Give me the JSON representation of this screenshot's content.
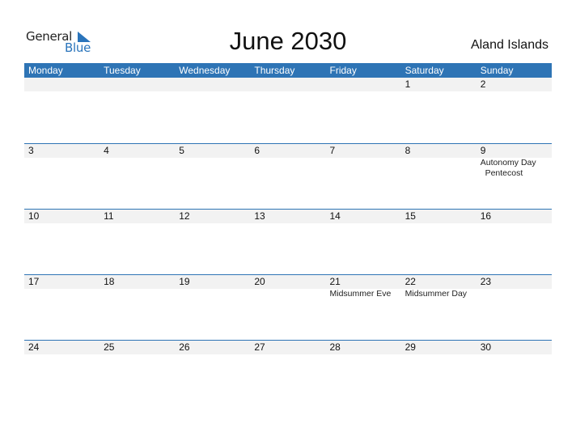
{
  "brand": {
    "general": "General",
    "blue": "Blue",
    "accent": "#2e74b5"
  },
  "title": "June 2030",
  "country": "Aland Islands",
  "days_header": [
    "Monday",
    "Tuesday",
    "Wednesday",
    "Thursday",
    "Friday",
    "Saturday",
    "Sunday"
  ],
  "weeks": [
    [
      {
        "d": ""
      },
      {
        "d": ""
      },
      {
        "d": ""
      },
      {
        "d": ""
      },
      {
        "d": ""
      },
      {
        "d": "1"
      },
      {
        "d": "2"
      }
    ],
    [
      {
        "d": "3"
      },
      {
        "d": "4"
      },
      {
        "d": "5"
      },
      {
        "d": "6"
      },
      {
        "d": "7"
      },
      {
        "d": "8"
      },
      {
        "d": "9",
        "events": [
          "Autonomy Day",
          "  Pentecost"
        ]
      }
    ],
    [
      {
        "d": "10"
      },
      {
        "d": "11"
      },
      {
        "d": "12"
      },
      {
        "d": "13"
      },
      {
        "d": "14"
      },
      {
        "d": "15"
      },
      {
        "d": "16"
      }
    ],
    [
      {
        "d": "17"
      },
      {
        "d": "18"
      },
      {
        "d": "19"
      },
      {
        "d": "20"
      },
      {
        "d": "21",
        "events": [
          "Midsummer Eve"
        ]
      },
      {
        "d": "22",
        "events": [
          "Midsummer Day"
        ]
      },
      {
        "d": "23"
      }
    ],
    [
      {
        "d": "24"
      },
      {
        "d": "25"
      },
      {
        "d": "26"
      },
      {
        "d": "27"
      },
      {
        "d": "28"
      },
      {
        "d": "29"
      },
      {
        "d": "30"
      }
    ]
  ]
}
